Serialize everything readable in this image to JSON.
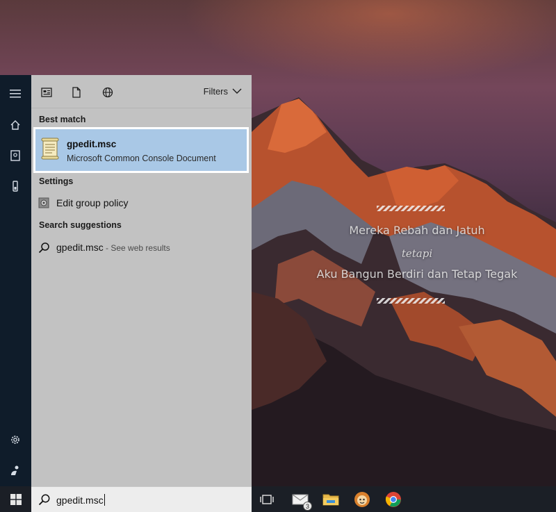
{
  "wallpaper": {
    "quote_line1": "Mereka Rebah dan Jatuh",
    "quote_line2": "tetapi",
    "quote_line3": "Aku Bangun Berdiri dan Tetap Tegak"
  },
  "rail": {
    "icons": [
      "menu-icon",
      "home-icon",
      "notebook-icon",
      "device-icon",
      "settings-icon",
      "feedback-icon"
    ]
  },
  "panel": {
    "top_icons": [
      "apps-icon",
      "documents-icon",
      "web-icon"
    ],
    "filters_label": "Filters",
    "best_match": {
      "heading": "Best match",
      "title": "gpedit.msc",
      "subtitle": "Microsoft Common Console Document"
    },
    "settings": {
      "heading": "Settings",
      "item": "Edit group policy"
    },
    "suggestions": {
      "heading": "Search suggestions",
      "item": "gpedit.msc",
      "item_suffix": " - See web results"
    }
  },
  "taskbar": {
    "search_value": "gpedit.msc",
    "mail_badge": "3",
    "icons": [
      "windows-icon",
      "task-view-icon",
      "mail-icon",
      "file-explorer-icon",
      "app-icon",
      "chrome-icon"
    ]
  },
  "colors": {
    "panel_bg": "#c2c2c2",
    "selection_bg": "#a9c8e6",
    "rail_bg": "#0f1c2a",
    "taskbar_bg": "#1b1f26"
  }
}
